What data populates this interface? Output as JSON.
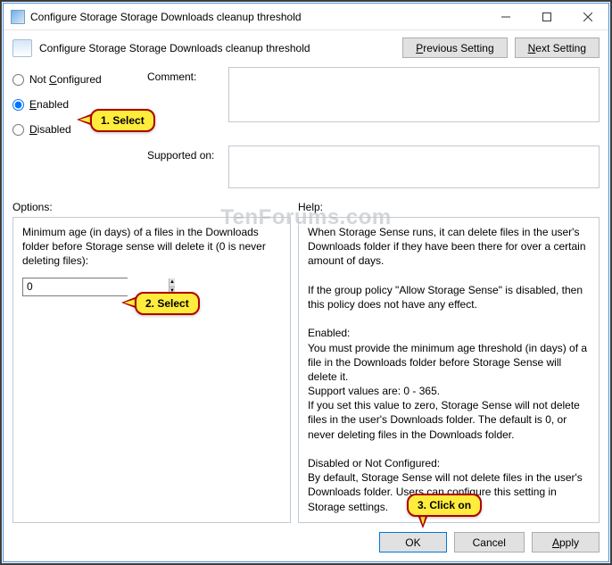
{
  "window": {
    "title": "Configure Storage Storage Downloads cleanup threshold"
  },
  "header": {
    "title": "Configure Storage Storage Downloads cleanup threshold",
    "prev": "Previous Setting",
    "next": "Next Setting"
  },
  "states": {
    "not_configured": "Not Configured",
    "enabled": "Enabled",
    "disabled": "Disabled",
    "selected": "enabled"
  },
  "labels": {
    "comment": "Comment:",
    "supported": "Supported on:",
    "options": "Options:",
    "help": "Help:"
  },
  "options": {
    "field_label": "Minimum age (in days) of a files in the Downloads folder before Storage sense will delete it (0 is never deleting files):",
    "value": "0"
  },
  "help_text": "When Storage Sense runs, it can delete files in the user's Downloads folder if they have been there for over a certain amount of days.\n\nIf the group policy \"Allow Storage Sense\" is disabled, then this policy does not have any effect.\n\nEnabled:\nYou must provide the minimum age threshold (in days) of a file in the Downloads folder before Storage Sense will delete it.\nSupport values are: 0 - 365.\nIf you set this value to zero, Storage Sense will not delete files in the user's Downloads folder. The default is 0, or never deleting files in the Downloads folder.\n\nDisabled or Not Configured:\nBy default, Storage Sense will not delete files in the user's Downloads folder. Users can configure this setting in Storage settings.",
  "buttons": {
    "ok": "OK",
    "cancel": "Cancel",
    "apply": "Apply"
  },
  "callouts": {
    "c1": "1. Select",
    "c2": "2. Select",
    "c3": "3. Click on"
  },
  "watermark": "TenForums.com"
}
